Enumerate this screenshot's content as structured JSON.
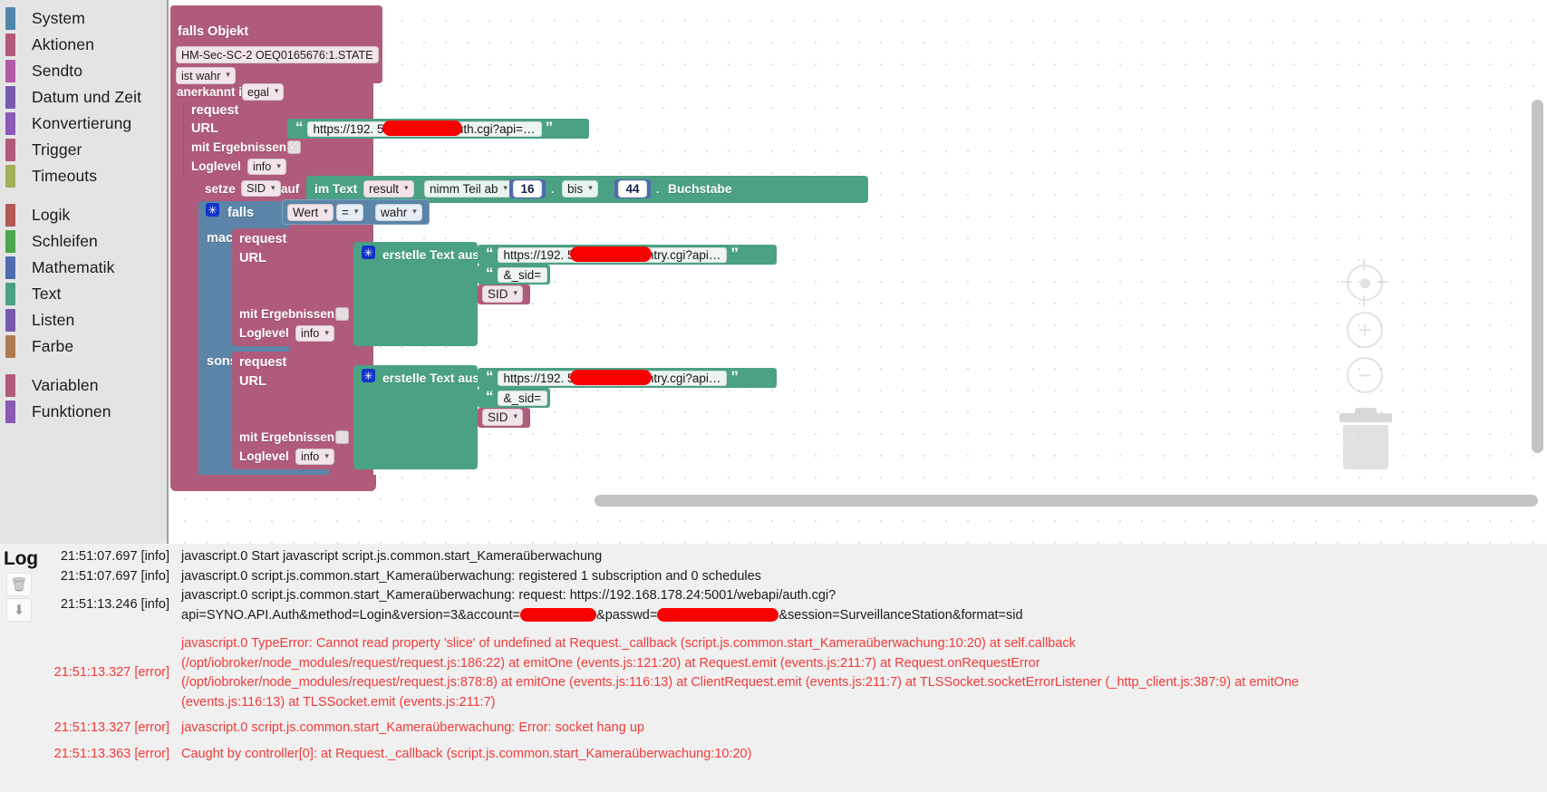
{
  "toolbox": {
    "groups": [
      {
        "items": [
          {
            "label": "System",
            "color": "#4f87ad"
          },
          {
            "label": "Aktionen",
            "color": "#b05b7c"
          },
          {
            "label": "Sendto",
            "color": "#b25aa8"
          },
          {
            "label": "Datum und Zeit",
            "color": "#7a5aad"
          },
          {
            "label": "Konvertierung",
            "color": "#8a5ab5"
          },
          {
            "label": "Trigger",
            "color": "#b05b7c"
          },
          {
            "label": "Timeouts",
            "color": "#a3ae5a"
          }
        ]
      },
      {
        "items": [
          {
            "label": "Logik",
            "color": "#b15a53"
          },
          {
            "label": "Schleifen",
            "color": "#4aa84a"
          },
          {
            "label": "Mathematik",
            "color": "#4f6bb0"
          },
          {
            "label": "Text",
            "color": "#4aa184"
          },
          {
            "label": "Listen",
            "color": "#7a5aad"
          },
          {
            "label": "Farbe",
            "color": "#b07a4f"
          }
        ]
      },
      {
        "items": [
          {
            "label": "Variablen",
            "color": "#b05b7c"
          },
          {
            "label": "Funktionen",
            "color": "#8a5ab5"
          }
        ]
      }
    ]
  },
  "workspace": {
    "trigger_block": {
      "title": "falls Objekt",
      "object_id": "HM-Sec-SC-2 OEQ0165676:1.STATE",
      "condition": "ist wahr",
      "ack_label": "anerkannt ist",
      "ack_value": "egal"
    },
    "request_outer": {
      "title": "request",
      "url_label": "URL",
      "url_value": "https://192.            5001/webapi/auth.cgi?api=…",
      "with_results_label": "mit Ergebnissen",
      "with_results_checked": true,
      "loglevel_label": "Loglevel",
      "loglevel_value": "info"
    },
    "set_var": {
      "set_label": "setze",
      "var_name": "SID",
      "to_label": "auf",
      "in_text_label": "im Text",
      "source_var": "result",
      "substring_label": "nimm Teil ab",
      "from_index": "16",
      "to_label2": "bis",
      "to_index": "44",
      "suffix_label": "Buchstabe"
    },
    "if_block": {
      "if_label": "falls",
      "left_operand": "Wert",
      "operator": "=",
      "right_operand": "wahr",
      "do_label": "mache",
      "else_label": "sonst"
    },
    "request_then": {
      "title": "request",
      "url_label": "URL",
      "create_text_label": "erstelle Text aus",
      "part1": "https://192.            5001/webapi/entry.cgi?api…",
      "part2": "&_sid=",
      "part3": "SID",
      "with_results_label": "mit Ergebnissen",
      "with_results_checked": false,
      "loglevel_label": "Loglevel",
      "loglevel_value": "info"
    },
    "request_else": {
      "title": "request",
      "url_label": "URL",
      "create_text_label": "erstelle Text aus",
      "part1": "https://192.            5001/webapi/entry.cgi?api…",
      "part2": "&_sid=",
      "part3": "SID",
      "with_results_label": "mit Ergebnissen",
      "with_results_checked": false,
      "loglevel_label": "Loglevel",
      "loglevel_value": "info"
    },
    "controls": {
      "center_icon": "target-icon",
      "zoom_in_icon": "plus-icon",
      "zoom_out_icon": "minus-icon",
      "trash_icon": "trash-icon",
      "zoom_in_label": "+",
      "zoom_out_label": "−"
    }
  },
  "log": {
    "title": "Log",
    "buttons": {
      "clear_icon": "trash-icon",
      "download_icon": "download-icon",
      "clear_glyph": "🗑",
      "download_glyph": "⬇"
    },
    "entries": [
      {
        "time": "21:51:07.697 [info]",
        "level": "info",
        "lines": [
          "javascript.0 Start javascript script.js.common.start_Kameraüberwachung"
        ]
      },
      {
        "time": "21:51:07.697 [info]",
        "level": "info",
        "lines": [
          "javascript.0 script.js.common.start_Kameraüberwachung: registered 1 subscription and 0 schedules"
        ]
      },
      {
        "time": "21:51:13.246 [info]",
        "level": "info",
        "lines": [
          "javascript.0 script.js.common.start_Kameraüberwachung: request: https://192.168.178.24:5001/webapi/auth.cgi?",
          "api=SYNO.API.Auth&method=Login&version=3&account=▮▮▮▮▮▮▮&passwd=▮▮▮▮▮▮▮▮▮▮▮▮▮&session=SurveillanceStation&format=sid"
        ]
      },
      {
        "time": "21:51:13.327 [error]",
        "level": "error",
        "lines": [
          "javascript.0 TypeError: Cannot read property 'slice' of undefined at Request._callback (script.js.common.start_Kameraüberwachung:10:20) at self.callback",
          "(/opt/iobroker/node_modules/request/request.js:186:22) at emitOne (events.js:121:20) at Request.emit (events.js:211:7) at Request.onRequestError",
          "(/opt/iobroker/node_modules/request/request.js:878:8) at emitOne (events.js:116:13) at ClientRequest.emit (events.js:211:7) at TLSSocket.socketErrorListener (_http_client.js:387:9) at emitOne",
          "(events.js:116:13) at TLSSocket.emit (events.js:211:7)"
        ]
      },
      {
        "time": "21:51:13.327 [error]",
        "level": "error",
        "lines": [
          "javascript.0 script.js.common.start_Kameraüberwachung: Error: socket hang up"
        ]
      },
      {
        "time": "21:51:13.363 [error]",
        "level": "error",
        "lines": [
          "Caught by controller[0]: at Request._callback (script.js.common.start_Kameraüberwachung:10:20)"
        ]
      }
    ]
  },
  "colors": {
    "logic_rose": "#b05b7c",
    "control_blue": "#5b84a8",
    "text_green": "#4aa184",
    "math_indigo": "#4f6bb0",
    "redaction": "#fb0000",
    "error_text": "#f23a3a"
  }
}
